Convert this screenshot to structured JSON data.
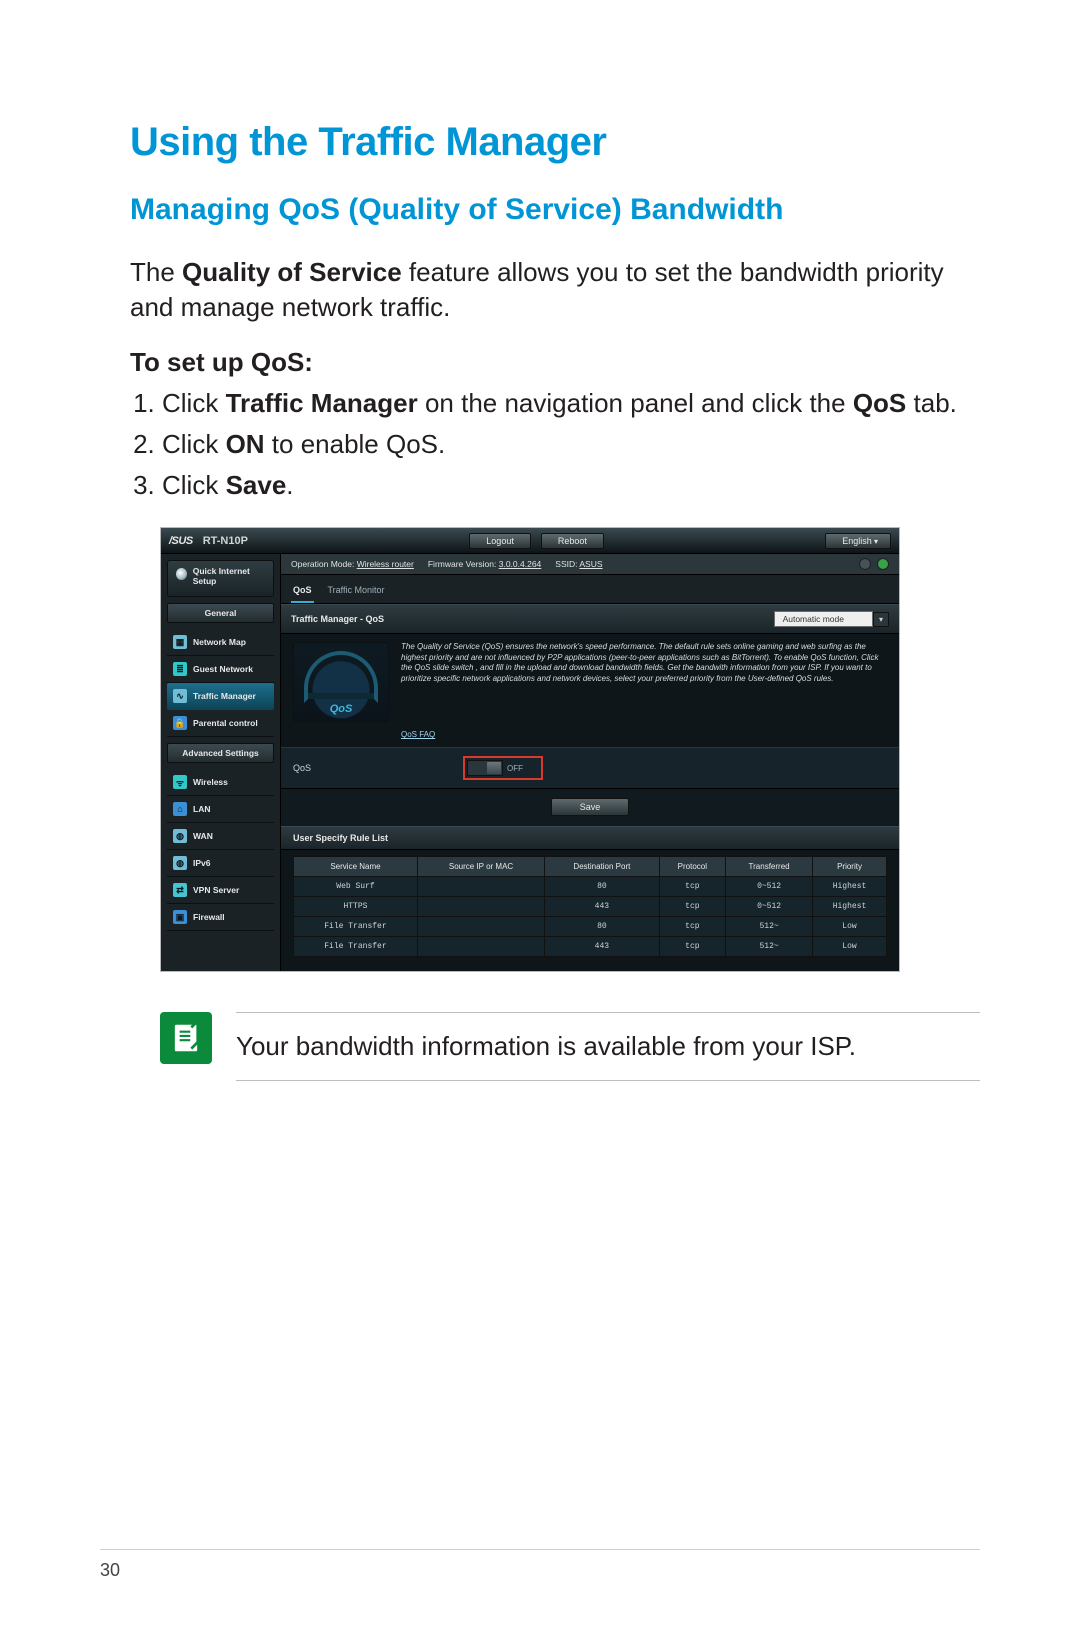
{
  "page": {
    "title": "Using the Traffic Manager",
    "subheading": "Managing QoS (Quality of Service) Bandwidth",
    "intro_pre": "The ",
    "intro_bold": "Quality of Service",
    "intro_post": " feature allows you to set the bandwidth priority and manage network traffic.",
    "steps_title": "To set up QoS:",
    "step1_pre": "Click ",
    "step1_b1": "Traffic Manager",
    "step1_mid": " on the navigation panel and click the ",
    "step1_b2": "QoS",
    "step1_post": " tab.",
    "step2_pre": "Click ",
    "step2_b": "ON",
    "step2_post": " to enable QoS.",
    "step3_pre": "Click ",
    "step3_b": "Save",
    "step3_post": ".",
    "note": "Your bandwidth information is available from your ISP.",
    "page_number": "30"
  },
  "ss": {
    "brand": "/SUS",
    "model": "RT-N10P",
    "logout": "Logout",
    "reboot": "Reboot",
    "lang": "English",
    "info": {
      "mode_label": "Operation Mode:",
      "mode_value": "Wireless router",
      "fw_label": "Firmware Version:",
      "fw_value": "3.0.0.4.264",
      "ssid_label": "SSID:",
      "ssid_value": "ASUS"
    },
    "quick_setup": "Quick Internet Setup",
    "section_general": "General",
    "nav": {
      "network_map": "Network Map",
      "guest_network": "Guest Network",
      "traffic_manager": "Traffic Manager",
      "parental_control": "Parental control"
    },
    "section_advanced": "Advanced Settings",
    "adv": {
      "wireless": "Wireless",
      "lan": "LAN",
      "wan": "WAN",
      "ipv6": "IPv6",
      "vpn": "VPN Server",
      "firewall": "Firewall"
    },
    "tabs": {
      "qos": "QoS",
      "monitor": "Traffic Monitor"
    },
    "section_title": "Traffic Manager - QoS",
    "mode": "Automatic mode",
    "gauge_label": "QoS",
    "desc": "The Quality of Service (QoS) ensures the network's speed performance. The default rule sets online gaming and web surfing as the highest priority and are not influenced by P2P applications (peer-to-peer applications such as BitTorrent). To enable QoS function, Click the QoS slide switch , and fill in the upload and download bandwidth fields. Get the bandwith information from your ISP. If you want to prioritize specific network applications and network devices, select your preferred priority from the User-defined QoS rules.",
    "faq": "QoS FAQ",
    "field_qos": "QoS",
    "toggle_state": "OFF",
    "save": "Save",
    "rule_list_title": "User Specify Rule List",
    "columns": {
      "service": "Service Name",
      "source": "Source IP or MAC",
      "dest": "Destination Port",
      "proto": "Protocol",
      "transfer": "Transferred",
      "priority": "Priority"
    },
    "rows": [
      {
        "service": "Web Surf",
        "source": "",
        "dest": "80",
        "proto": "tcp",
        "transfer": "0~512",
        "priority": "Highest"
      },
      {
        "service": "HTTPS",
        "source": "",
        "dest": "443",
        "proto": "tcp",
        "transfer": "0~512",
        "priority": "Highest"
      },
      {
        "service": "File Transfer",
        "source": "",
        "dest": "80",
        "proto": "tcp",
        "transfer": "512~",
        "priority": "Low"
      },
      {
        "service": "File Transfer",
        "source": "",
        "dest": "443",
        "proto": "tcp",
        "transfer": "512~",
        "priority": "Low"
      }
    ]
  }
}
